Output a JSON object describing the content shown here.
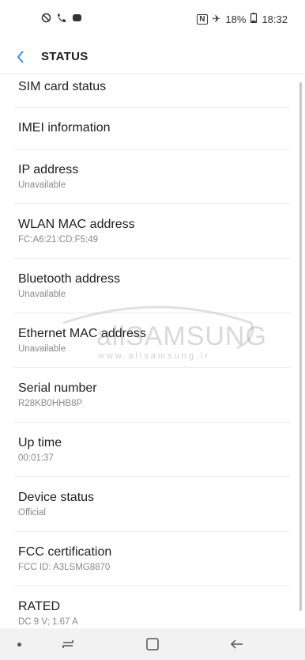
{
  "status_bar": {
    "left_icons": [
      "blocked-icon",
      "missed-call-icon",
      "message-icon"
    ],
    "nfc": "N",
    "airplane": "✈",
    "battery": "18%",
    "time": "18:32"
  },
  "header": {
    "title": "STATUS"
  },
  "items": [
    {
      "primary": "SIM card status"
    },
    {
      "primary": "IMEI information"
    },
    {
      "primary": "IP address",
      "secondary": "Unavailable"
    },
    {
      "primary": "WLAN MAC address",
      "secondary": "FC:A6:21:CD:F5:49"
    },
    {
      "primary": "Bluetooth address",
      "secondary": "Unavailable"
    },
    {
      "primary": "Ethernet MAC address",
      "secondary": "Unavailable"
    },
    {
      "primary": "Serial number",
      "secondary": "R28KB0HHB8P"
    },
    {
      "primary": "Up time",
      "secondary": "00:01:37"
    },
    {
      "primary": "Device status",
      "secondary": "Official"
    },
    {
      "primary": "FCC certification",
      "secondary": "FCC ID: A3LSMG8870"
    },
    {
      "primary": "RATED",
      "secondary": "DC 9 V; 1.67 A"
    }
  ],
  "watermark": {
    "text": "allSAMSUNG",
    "url": "www.allsamsung.ir"
  }
}
